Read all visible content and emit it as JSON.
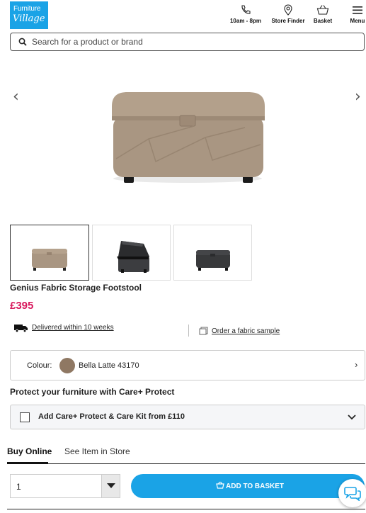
{
  "header": {
    "logo_line1": "Furniture",
    "logo_line2": "Village",
    "hours_label": "10am - 8pm",
    "store_finder_label": "Store Finder",
    "basket_label": "Basket",
    "menu_label": "Menu"
  },
  "search": {
    "placeholder": "Search for a product or brand"
  },
  "gallery": {
    "prev_glyph": "‹",
    "next_glyph": "›",
    "thumbnail_count": 3,
    "selected_thumbnail": 1
  },
  "product": {
    "title": "Genius Fabric Storage Footstool",
    "price": "£395",
    "delivery_text": "Delivered within 10 weeks",
    "sample_text": "Order a fabric sample"
  },
  "colour": {
    "label": "Colour:",
    "name": "Bella Latte 43170",
    "swatch_color": "#8f7863",
    "chevron": "›"
  },
  "care": {
    "heading": "Protect your furniture with Care+ Protect",
    "option_label": "Add Care+ Protect & Care Kit from £110",
    "checked": false
  },
  "tabs": [
    {
      "label": "Buy Online",
      "active": true
    },
    {
      "label": "See Item in Store",
      "active": false
    }
  ],
  "purchase": {
    "quantity": "1",
    "add_label": "ADD TO BASKET"
  },
  "colors": {
    "brand_blue": "#1aa3e6",
    "price_pink": "#d8195d"
  }
}
